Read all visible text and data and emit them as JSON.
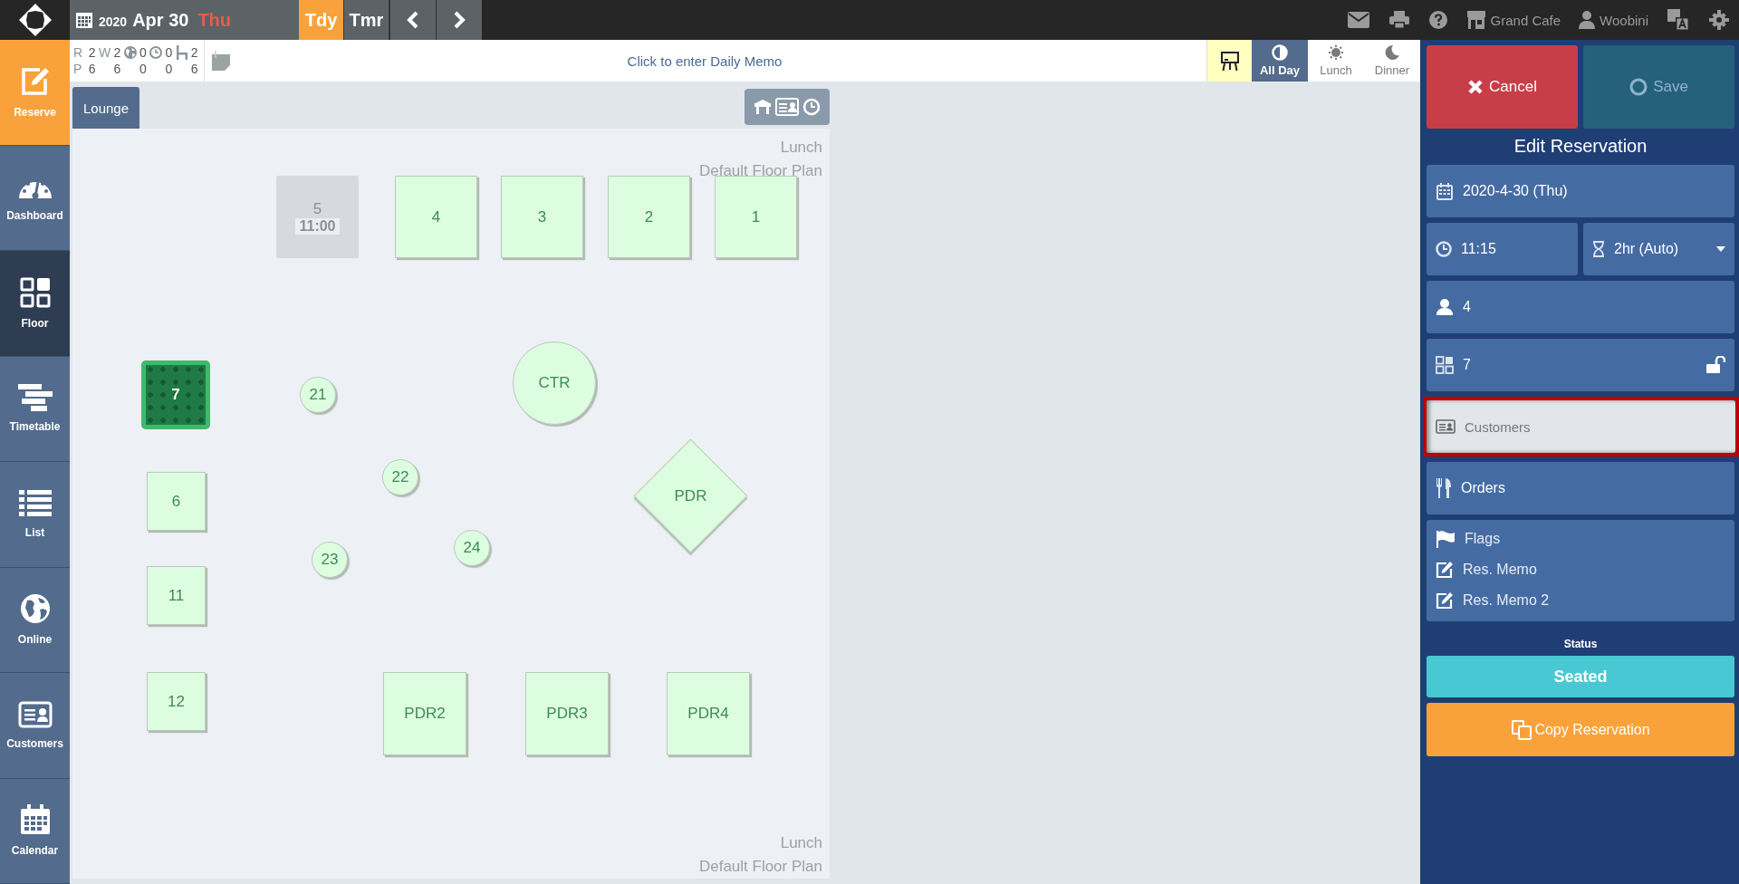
{
  "top_bar": {
    "year": "2020",
    "date": "Apr 30",
    "weekday": "Thu",
    "day_buttons": [
      {
        "label": "Tdy",
        "selected": true
      },
      {
        "label": "Tmr",
        "selected": false
      }
    ],
    "venue": "Grand Cafe",
    "user": "Woobini"
  },
  "sidebar": {
    "items": [
      {
        "label": "Reserve",
        "kind": "reserve",
        "selected": false
      },
      {
        "label": "Dashboard",
        "kind": "dashboard",
        "selected": false
      },
      {
        "label": "Floor",
        "kind": "floor",
        "selected": true
      },
      {
        "label": "Timetable",
        "kind": "timetable",
        "selected": false
      },
      {
        "label": "List",
        "kind": "list",
        "selected": false
      },
      {
        "label": "Online",
        "kind": "online",
        "selected": false
      },
      {
        "label": "Customers",
        "kind": "customers",
        "selected": false
      },
      {
        "label": "Calendar",
        "kind": "calendar",
        "selected": false
      }
    ]
  },
  "stats": {
    "groups_label": "R",
    "people_label": "P",
    "columns": [
      {
        "kind": "plain",
        "groups": "2",
        "people": "6"
      },
      {
        "kind": "text",
        "label": "W",
        "groups": "2",
        "people": "6"
      },
      {
        "kind": "globe",
        "groups": "0",
        "people": "0"
      },
      {
        "kind": "clock",
        "groups": "0",
        "people": "0"
      },
      {
        "kind": "chair",
        "groups": "2",
        "people": "6"
      }
    ]
  },
  "daily_memo": "Click to enter Daily Memo",
  "meal_periods": [
    {
      "label": "All Day",
      "kind": "allday",
      "selected": true
    },
    {
      "label": "Lunch",
      "kind": "lunch",
      "selected": false
    },
    {
      "label": "Dinner",
      "kind": "dinner",
      "selected": false
    }
  ],
  "floor": {
    "tabs": [
      {
        "label": "Lounge",
        "selected": true
      }
    ],
    "top_caption": {
      "period": "Lunch",
      "plan": "Default Floor Plan"
    },
    "bottom_caption": {
      "period": "Lunch",
      "plan": "Default Floor Plan"
    },
    "tables": [
      {
        "label": "5",
        "kind": "square",
        "blocked": true,
        "selected": false,
        "time": "11:00"
      },
      {
        "label": "4",
        "kind": "square",
        "blocked": false,
        "selected": false
      },
      {
        "label": "3",
        "kind": "square",
        "blocked": false,
        "selected": false
      },
      {
        "label": "2",
        "kind": "square",
        "blocked": false,
        "selected": false
      },
      {
        "label": "1",
        "kind": "square",
        "blocked": false,
        "selected": false
      },
      {
        "label": "7",
        "kind": "square",
        "blocked": false,
        "selected": true
      },
      {
        "label": "21",
        "kind": "round",
        "blocked": false,
        "selected": false
      },
      {
        "label": "CTR",
        "kind": "round",
        "blocked": false,
        "selected": false
      },
      {
        "label": "22",
        "kind": "round",
        "blocked": false,
        "selected": false
      },
      {
        "label": "PDR",
        "kind": "diamond",
        "blocked": false,
        "selected": false
      },
      {
        "label": "6",
        "kind": "square",
        "blocked": false,
        "selected": false
      },
      {
        "label": "23",
        "kind": "round",
        "blocked": false,
        "selected": false
      },
      {
        "label": "24",
        "kind": "round",
        "blocked": false,
        "selected": false
      },
      {
        "label": "11",
        "kind": "square",
        "blocked": false,
        "selected": false
      },
      {
        "label": "12",
        "kind": "square",
        "blocked": false,
        "selected": false
      },
      {
        "label": "PDR2",
        "kind": "square",
        "blocked": false,
        "selected": false
      },
      {
        "label": "PDR3",
        "kind": "square",
        "blocked": false,
        "selected": false
      },
      {
        "label": "PDR4",
        "kind": "square",
        "blocked": false,
        "selected": false
      }
    ]
  },
  "panel": {
    "cancel": "Cancel",
    "save": "Save",
    "save_disabled": true,
    "title": "Edit Reservation",
    "date": "2020-4-30 (Thu)",
    "time": "11:15",
    "duration": "2hr (Auto)",
    "guests": "4",
    "table": "7",
    "table_locked": false,
    "customers": {
      "placeholder": "Customers",
      "highlighted": true
    },
    "orders": "Orders",
    "extras": [
      {
        "label": "Flags",
        "kind": "flag"
      },
      {
        "label": "Res. Memo",
        "kind": "memo"
      },
      {
        "label": "Res. Memo 2",
        "kind": "memo"
      }
    ],
    "status_label": "Status",
    "status": "Seated",
    "copy": "Copy Reservation"
  }
}
